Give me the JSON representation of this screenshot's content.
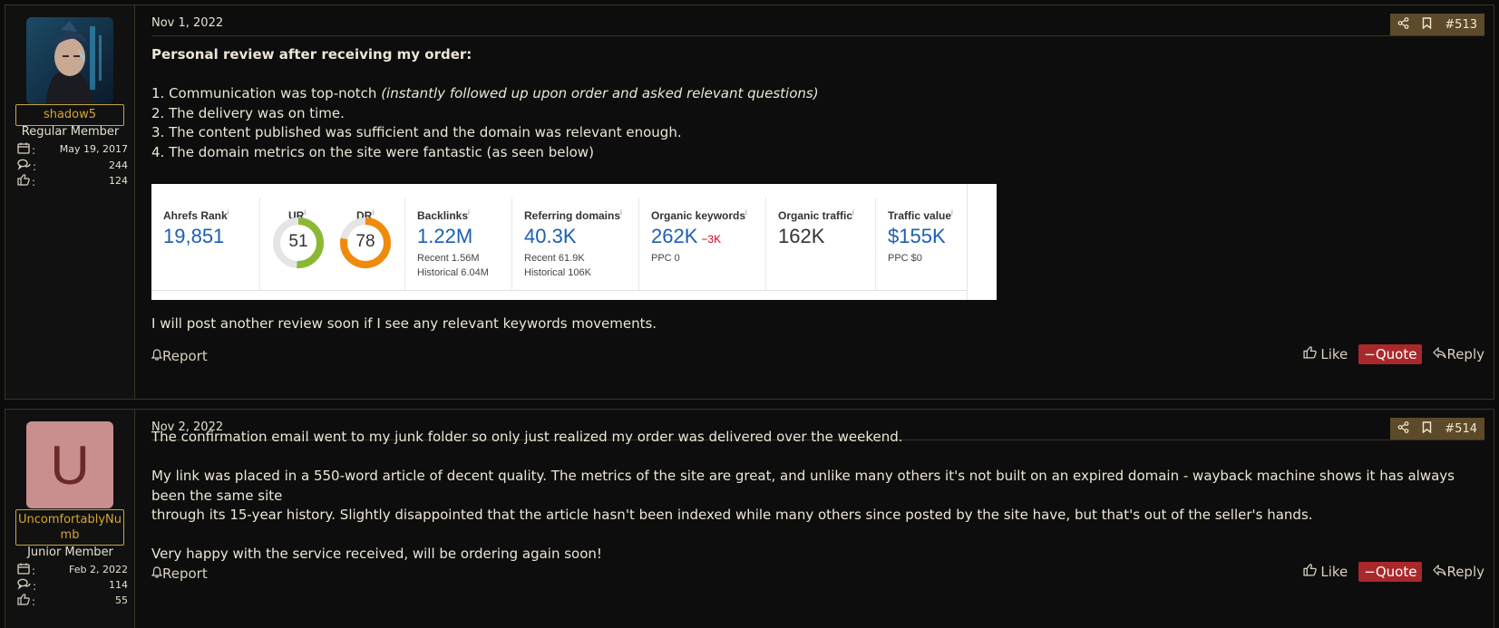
{
  "posts": [
    {
      "user": {
        "name": "shadow5",
        "role": "Regular Member",
        "joined": "May 19, 2017",
        "messages": "244",
        "reactions": "124"
      },
      "date": "Nov 1, 2022",
      "number": "#513",
      "heading": "Personal review after receiving my order:",
      "list": [
        {
          "text": "1. Communication was top-notch ",
          "italic": "(instantly followed up upon order and asked relevant questions)"
        },
        {
          "text": "2. The delivery was on time."
        },
        {
          "text": "3. The content published was sufficient and the domain was relevant enough."
        },
        {
          "text": "4. The domain metrics on the site were fantastic (as seen below)"
        }
      ],
      "closing": "I will post another review soon if I see any relevant keywords movements.",
      "metrics": {
        "ahrefs_rank": {
          "label": "Ahrefs Rank",
          "value": "19,851"
        },
        "ur": {
          "label": "UR",
          "value": "51",
          "fraction": 0.51,
          "color": "#8ab834"
        },
        "dr": {
          "label": "DR",
          "value": "78",
          "fraction": 0.78,
          "color": "#f08a0c"
        },
        "backlinks": {
          "label": "Backlinks",
          "value": "1.22M",
          "recent": "Recent 1.56M",
          "historical": "Historical 6.04M"
        },
        "referring": {
          "label": "Referring domains",
          "value": "40.3K",
          "recent": "Recent 61.9K",
          "historical": "Historical 106K"
        },
        "organic_keywords": {
          "label": "Organic keywords",
          "value": "262K",
          "delta": "−3K",
          "ppc": "PPC 0"
        },
        "organic_traffic": {
          "label": "Organic traffic",
          "value": "162K"
        },
        "traffic_value": {
          "label": "Traffic value",
          "value": "$155K",
          "ppc": "PPC $0"
        }
      }
    },
    {
      "user": {
        "name": "UncomfortablyNumb",
        "name_line1": "UncomfortablyNu",
        "name_line2": "mb",
        "initial": "U",
        "role": "Junior Member",
        "joined": "Feb 2, 2022",
        "messages": "114",
        "reactions": "55"
      },
      "date": "Nov 2, 2022",
      "number": "#514",
      "para1": "The confirmation email went to my junk folder so only just realized my order was delivered over the weekend.",
      "para2a": "My link was placed in a 550-word article of decent quality. The metrics of the site are great, and unlike many others it's not built on an expired domain - wayback machine shows it has always been the same site",
      "para2b": "through its 15-year history. Slightly disappointed that the article hasn't been indexed while many others since posted by the site have, but that's out of the seller's hands.",
      "para3": "Very happy with the service received, will be ordering again soon!"
    }
  ],
  "labels": {
    "report": "Report",
    "like": "Like",
    "quote": "Quote",
    "reply": "Reply",
    "info": "i",
    "colon": ":"
  },
  "icons": {
    "calendar": "calendar-icon",
    "messages": "messages-icon",
    "reactions": "thumbs-up-icon",
    "share": "share-icon",
    "bookmark": "bookmark-icon",
    "bell": "bell-icon",
    "reply": "reply-icon",
    "minus": "minus-icon"
  },
  "colors": {
    "username": "#d6a637",
    "quote_bg": "#a9282b",
    "actions_bg": "#5c4a2a",
    "metric_blue": "#1a5fb4"
  }
}
